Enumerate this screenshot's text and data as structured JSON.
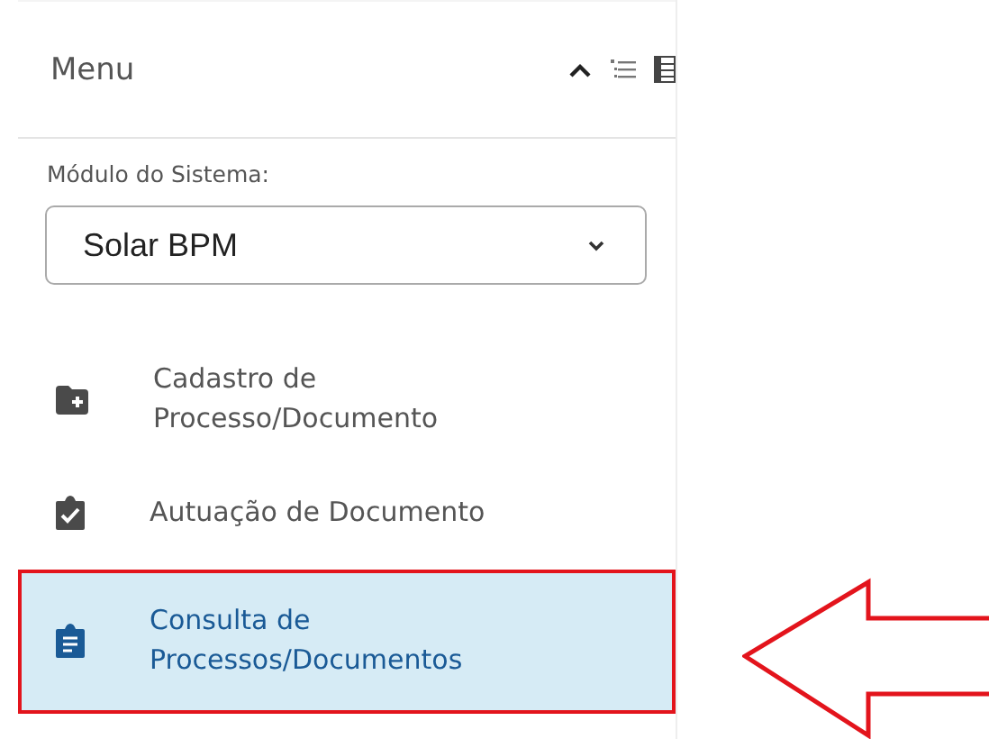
{
  "sidebar": {
    "title": "Menu",
    "module": {
      "label": "Módulo do Sistema:",
      "value": "Solar BPM"
    },
    "items": [
      {
        "label": "Cadastro de Processo/Documento",
        "selected": false
      },
      {
        "label": "Autuação de Documento",
        "selected": false
      },
      {
        "label": "Consulta de Processos/Documentos",
        "selected": true
      }
    ]
  }
}
